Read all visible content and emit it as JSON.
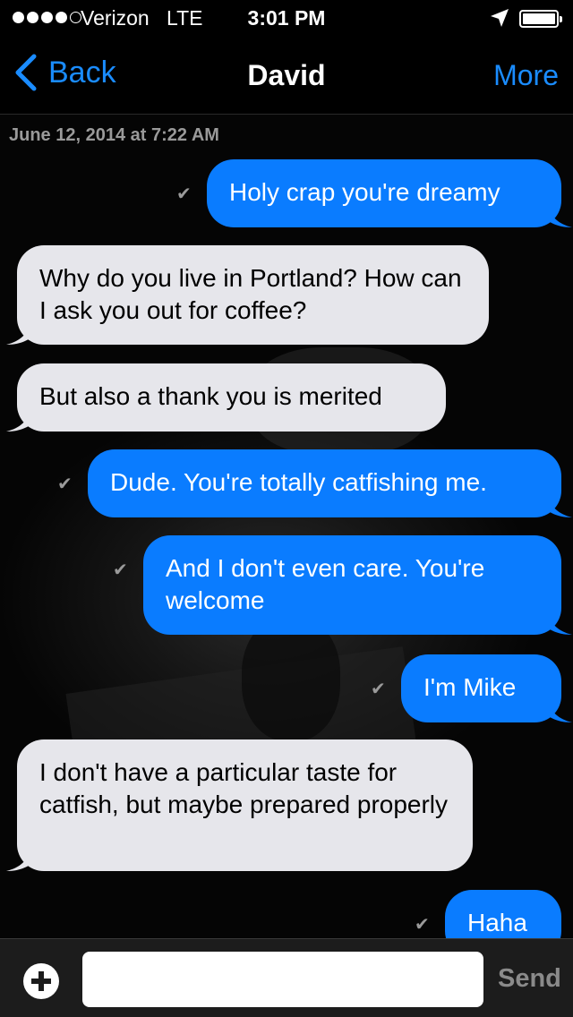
{
  "status_bar": {
    "carrier": "Verizon",
    "network": "LTE",
    "time": "3:01 PM",
    "signal_bars": 4,
    "battery_level": 0.9
  },
  "nav": {
    "back_label": "Back",
    "title": "David",
    "more_label": "More"
  },
  "thread": {
    "date": "June 12, 2014 at 7:22 AM",
    "check_glyph": "✔",
    "messages": [
      {
        "direction": "out",
        "text": "Holy crap you're dreamy"
      },
      {
        "direction": "in",
        "text": "Why do you live in Portland? How can I ask you out for coffee?"
      },
      {
        "direction": "in",
        "text": "But also a thank you is merited"
      },
      {
        "direction": "out",
        "text": "Dude. You're totally catfishing me."
      },
      {
        "direction": "out",
        "text": "And I don't even care. You're welcome"
      },
      {
        "direction": "out",
        "text": "I'm Mike"
      },
      {
        "direction": "in",
        "text": "I don't have a particular taste for catfish, but maybe prepared properly"
      },
      {
        "direction": "out",
        "text": "Haha"
      }
    ]
  },
  "input_bar": {
    "placeholder": "",
    "send_label": "Send"
  },
  "colors": {
    "accent": "#1a8cff",
    "outgoing_bubble": "#0a7cff",
    "incoming_bubble": "#e6e6eb",
    "background": "#000000"
  }
}
